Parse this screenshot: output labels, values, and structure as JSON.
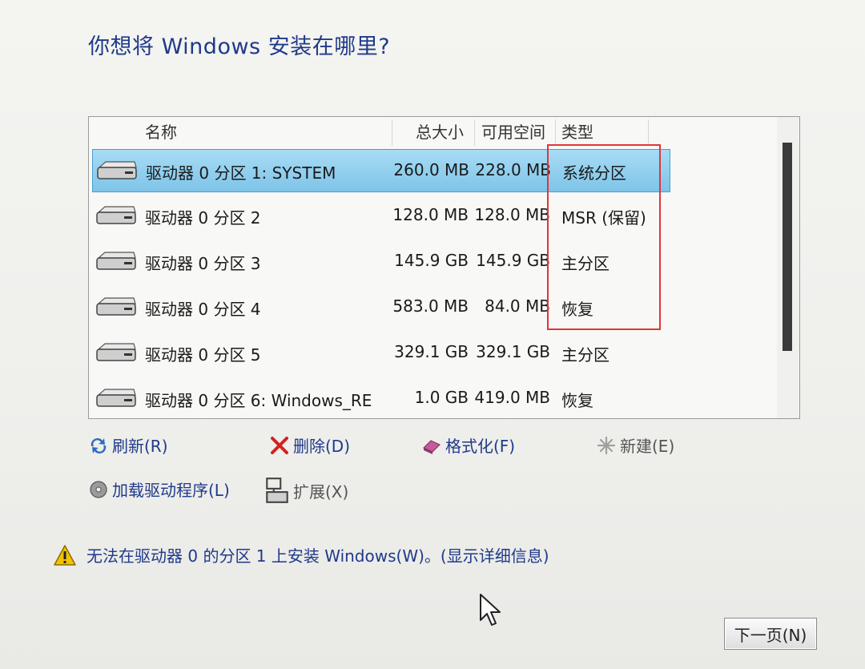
{
  "title": "你想将 Windows 安装在哪里?",
  "table": {
    "headers": {
      "name": "名称",
      "total": "总大小",
      "free": "可用空间",
      "type": "类型"
    },
    "rows": [
      {
        "name": "驱动器 0 分区 1: SYSTEM",
        "total": "260.0 MB",
        "free": "228.0 MB",
        "type": "系统分区",
        "selected": true
      },
      {
        "name": "驱动器 0 分区 2",
        "total": "128.0 MB",
        "free": "128.0 MB",
        "type": "MSR (保留)",
        "selected": false
      },
      {
        "name": "驱动器 0 分区 3",
        "total": "145.9 GB",
        "free": "145.9 GB",
        "type": "主分区",
        "selected": false
      },
      {
        "name": "驱动器 0 分区 4",
        "total": "583.0 MB",
        "free": "84.0 MB",
        "type": "恢复",
        "selected": false
      },
      {
        "name": "驱动器 0 分区 5",
        "total": "329.1 GB",
        "free": "329.1 GB",
        "type": "主分区",
        "selected": false
      },
      {
        "name": "驱动器 0 分区 6: Windows_RE",
        "total": "1.0 GB",
        "free": "419.0 MB",
        "type": "恢复",
        "selected": false
      }
    ]
  },
  "actions": {
    "refresh": "刷新(R)",
    "delete": "删除(D)",
    "format": "格式化(F)",
    "new": "新建(E)",
    "load_driver": "加载驱动程序(L)",
    "extend": "扩展(X)"
  },
  "warning": {
    "text": "无法在驱动器 0 的分区 1 上安装 Windows(W)。(显示详细信息)"
  },
  "next_button": "下一页(N)",
  "colors": {
    "title": "#1f3a8a",
    "selection": "#7ec4e8",
    "annotation": "#e3343a"
  }
}
